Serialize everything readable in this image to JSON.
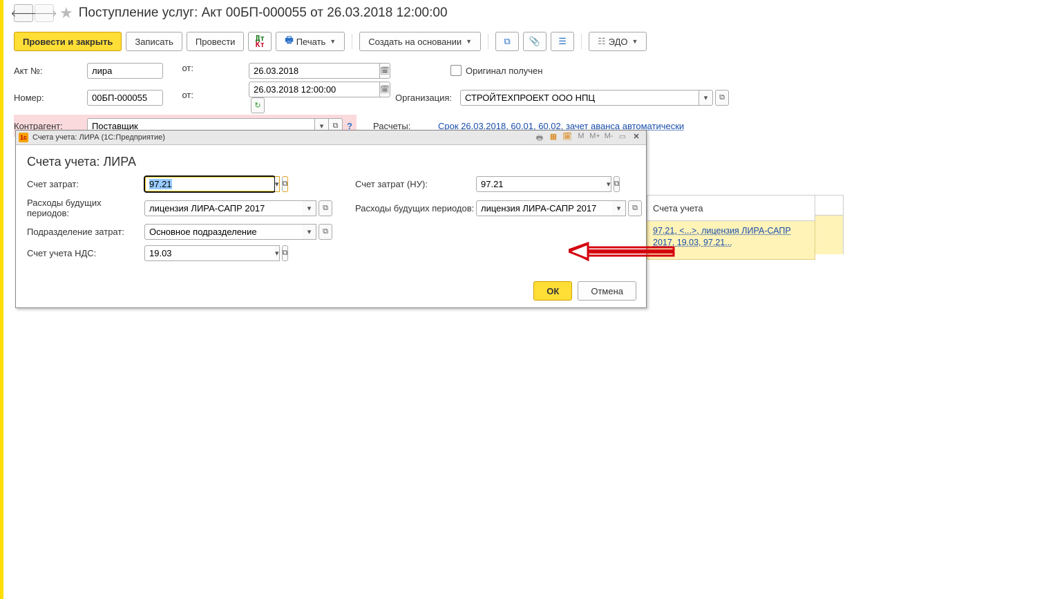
{
  "header": {
    "title": "Поступление услуг: Акт 00БП-000055 от 26.03.2018 12:00:00"
  },
  "toolbar": {
    "post_close": "Провести и закрыть",
    "save": "Записать",
    "post": "Провести",
    "print": "Печать",
    "create_based": "Создать на основании",
    "edo": "ЭДО"
  },
  "form": {
    "act_no_label": "Акт №:",
    "act_no_value": "лира",
    "from_label": "от:",
    "act_date": "26.03.2018",
    "number_label": "Номер:",
    "number_value": "00БП-000055",
    "number_date": "26.03.2018 12:00:00",
    "counterparty_label": "Контрагент:",
    "counterparty_value": "Поставщик",
    "help": "?",
    "original_label": "Оригинал получен",
    "org_label": "Организация:",
    "org_value": "СТРОЙТЕХПРОЕКТ ООО НПЦ",
    "calc_label": "Расчеты:",
    "calc_link": "Срок 26.03.2018, 60.01, 60.02, зачет аванса автоматически"
  },
  "accounts_col": {
    "header": "Счета учета",
    "link": "97.21, <...>, лицензия ЛИРА-САПР 2017, 19.03, 97.21..."
  },
  "dialog": {
    "window_title": "Счета учета: ЛИРА  (1С:Предприятие)",
    "title": "Счета учета: ЛИРА",
    "cost_acc_label": "Счет затрат:",
    "cost_acc_value": "97.21",
    "cost_acc_nu_label": "Счет затрат (НУ):",
    "cost_acc_nu_value": "97.21",
    "rbp_label": "Расходы будущих периодов:",
    "rbp_value": "лицензия ЛИРА-САПР 2017",
    "rbp_nu_value": "лицензия ЛИРА-САПР 2017",
    "dept_label": "Подразделение затрат:",
    "dept_value": "Основное подразделение",
    "vat_label": "Счет учета НДС:",
    "vat_value": "19.03",
    "ok": "ОК",
    "cancel": "Отмена",
    "m": "M",
    "mplus": "M+",
    "mminus": "M-"
  }
}
